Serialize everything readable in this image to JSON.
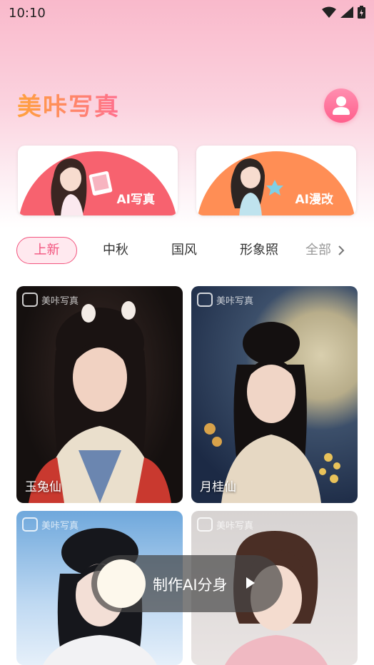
{
  "status_bar": {
    "time": "10:10"
  },
  "header": {
    "app_title": "美咔写真"
  },
  "feature_cards": [
    {
      "label": "AI写真"
    },
    {
      "label": "AI漫改"
    }
  ],
  "tabs": [
    {
      "label": "上新",
      "active": true
    },
    {
      "label": "中秋"
    },
    {
      "label": "国风"
    },
    {
      "label": "形象照"
    },
    {
      "label": "全部"
    }
  ],
  "watermark": "美咔写真",
  "photos": [
    {
      "caption": "玉兔仙"
    },
    {
      "caption": "月桂仙"
    },
    {
      "caption": ""
    },
    {
      "caption": ""
    }
  ],
  "floating_button": {
    "label": "制作AI分身"
  },
  "colors": {
    "accent": "#f2547e",
    "card_left": "#f7626f",
    "card_right": "#ff8e55"
  }
}
